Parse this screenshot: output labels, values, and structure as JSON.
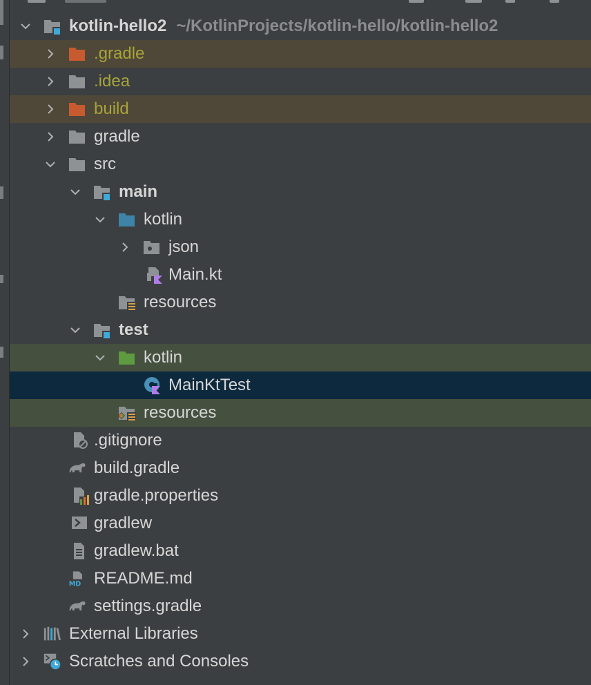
{
  "project_root": {
    "name": "kotlin-hello2",
    "path": "~/KotlinProjects/kotlin-hello/kotlin-hello2"
  },
  "tree": {
    "gradle_dir": ".gradle",
    "idea_dir": ".idea",
    "build_dir": "build",
    "gradle_folder": "gradle",
    "src": "src",
    "main": "main",
    "main_kotlin": "kotlin",
    "json_pkg": "json",
    "main_kt": "Main.kt",
    "main_resources": "resources",
    "test": "test",
    "test_kotlin": "kotlin",
    "mainkt_test": "MainKtTest",
    "test_resources": "resources",
    "gitignore": ".gitignore",
    "build_gradle": "build.gradle",
    "gradle_properties": "gradle.properties",
    "gradlew": "gradlew",
    "gradlew_bat": "gradlew.bat",
    "readme": "README.md",
    "settings_gradle": "settings.gradle",
    "external_libraries": "External Libraries",
    "scratches": "Scratches and Consoles"
  },
  "icons": {
    "folder": "folder-icon",
    "excluded_folder": "excluded-folder-icon",
    "module_folder": "module-folder-icon",
    "source_root": "source-root-icon",
    "test_root": "test-root-icon",
    "package": "package-icon",
    "kotlin_file": "kotlin-file-icon",
    "resources": "resources-root-icon",
    "test_resources": "test-resources-root-icon",
    "test_class": "test-class-icon",
    "gitignore": "gitignore-icon",
    "gradle_elephant": "gradle-icon",
    "properties": "properties-icon",
    "shell": "shell-script-icon",
    "text": "text-file-icon",
    "markdown": "markdown-icon",
    "libraries": "libraries-icon",
    "scratches": "scratches-icon"
  },
  "colors": {
    "background": "#3c3f41",
    "selection": "#0d293e",
    "ignored_text": "#a8a33a",
    "excluded_folder": "#c75b2f",
    "source_root": "#3d84a8",
    "test_root": "#5e9a40",
    "folder": "#8f9294"
  }
}
